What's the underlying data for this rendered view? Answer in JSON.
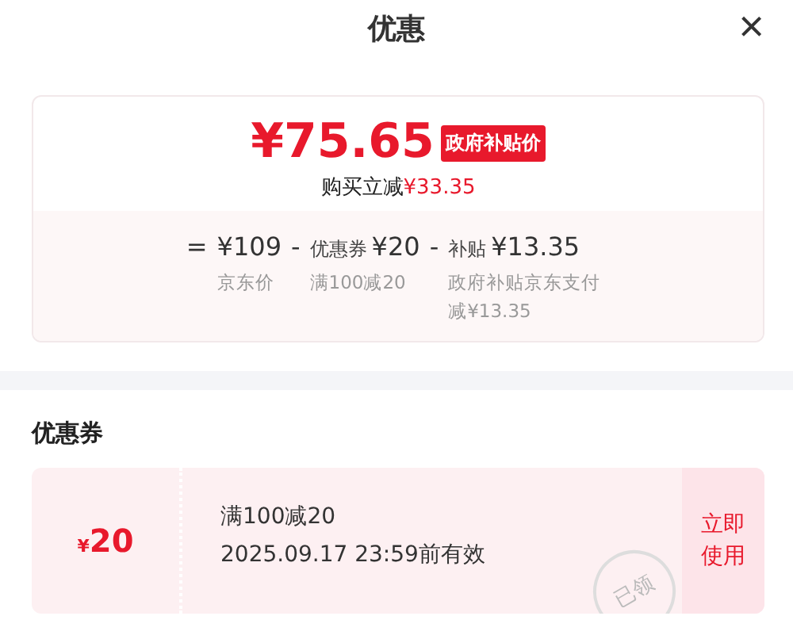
{
  "header": {
    "title": "优惠",
    "close": "×"
  },
  "price": {
    "amount": "¥75.65",
    "tag": "政府补贴价",
    "saving_label": "购买立减",
    "saving": "¥33.35"
  },
  "breakdown": [
    {
      "operator": "=",
      "amount": "¥109",
      "note": "京东价"
    },
    {
      "operator": "-",
      "label": "优惠券",
      "amount": "¥20",
      "note": "满100减20"
    },
    {
      "operator": "-",
      "label": "补贴",
      "amount": "¥13.35",
      "note": "政府补贴京东支付减¥13.35"
    }
  ],
  "coupons_title": "优惠券",
  "coupons": [
    {
      "currency": "¥",
      "value": "20",
      "name": "满100减20",
      "validity": "2025.09.17 23:59前有效",
      "stamp": "已领",
      "action": "立即使用"
    }
  ]
}
